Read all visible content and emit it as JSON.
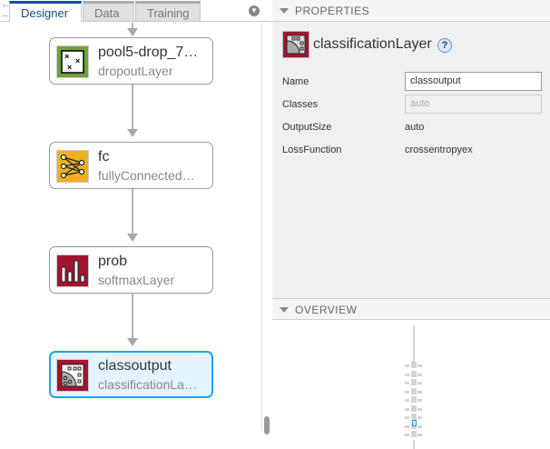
{
  "tabs": [
    {
      "label": "Designer"
    },
    {
      "label": "Data"
    },
    {
      "label": "Training"
    }
  ],
  "nodes": [
    {
      "name": "pool5-drop_7…",
      "type": "dropoutLayer",
      "icon": "dropout-icon",
      "color": "#6fa23a"
    },
    {
      "name": "fc",
      "type": "fullyConnected…",
      "icon": "fully-connected-icon",
      "color": "#edb120"
    },
    {
      "name": "prob",
      "type": "softmaxLayer",
      "icon": "softmax-icon",
      "color": "#a2142f"
    },
    {
      "name": "classoutput",
      "type": "classificationLa…",
      "icon": "classification-icon",
      "color": "#a2142f",
      "selected": true
    }
  ],
  "properties": {
    "header": "PROPERTIES",
    "layer_type": "classificationLayer",
    "help": "?",
    "rows": [
      {
        "label": "Name",
        "value": "classoutput",
        "kind": "input"
      },
      {
        "label": "Classes",
        "value": "auto",
        "kind": "disabled"
      },
      {
        "label": "OutputSize",
        "value": "auto",
        "kind": "text"
      },
      {
        "label": "LossFunction",
        "value": "crossentropyex",
        "kind": "text"
      }
    ]
  },
  "overview": {
    "header": "OVERVIEW"
  },
  "colors": {
    "accent": "#1ea1ef",
    "tab_active": "#0b4e9a"
  }
}
